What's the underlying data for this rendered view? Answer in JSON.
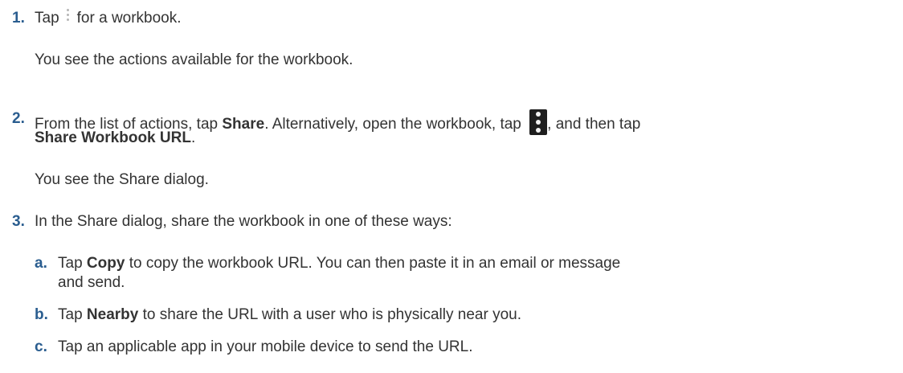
{
  "steps": [
    {
      "number": "1.",
      "text_before_icon": "Tap",
      "icon": "kebab-menu-icon",
      "text_after_icon": "for a workbook.",
      "result": "You see the actions available for the workbook."
    },
    {
      "number": "2.",
      "text_part1": "From the list of actions, tap ",
      "bold1": "Share",
      "text_part2": ". Alternatively, open the workbook, tap ",
      "icon": "more-actions-icon",
      "text_part3": ", and then tap",
      "bold2": "Share Workbook URL",
      "text_part4": ".",
      "result": "You see the Share dialog."
    },
    {
      "number": "3.",
      "text": "In the Share dialog, share the workbook in one of these ways:",
      "substeps": [
        {
          "letter": "a.",
          "prefix": "Tap ",
          "bold": "Copy",
          "line1_rest": " to copy the workbook URL. You can then paste it in an email or message",
          "line2": "and send."
        },
        {
          "letter": "b.",
          "prefix": "Tap ",
          "bold": "Nearby",
          "rest": " to share the URL with a user who is physically near you."
        },
        {
          "letter": "c.",
          "text": "Tap an applicable app in your mobile device to send the URL."
        }
      ]
    }
  ]
}
